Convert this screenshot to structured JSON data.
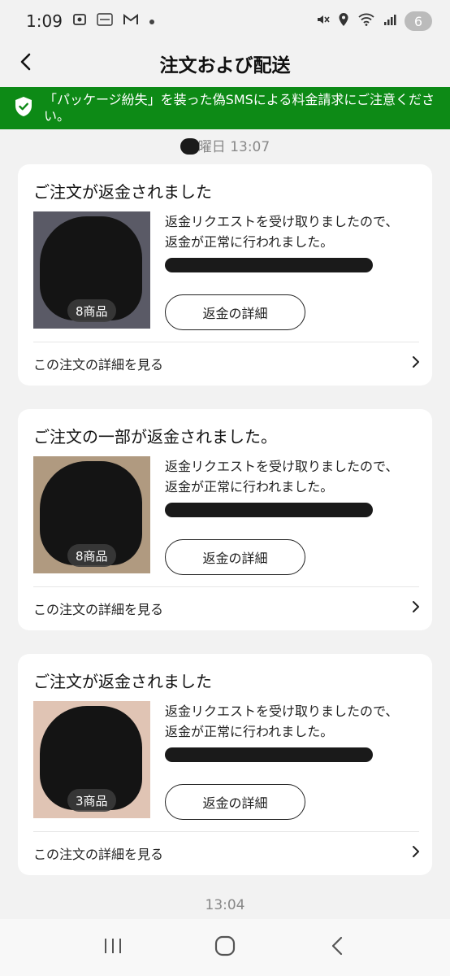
{
  "status_bar": {
    "time": "1:09",
    "icons": [
      "screenshot-icon",
      "temu-icon",
      "gmail-icon",
      "dot-icon"
    ],
    "right_icons": [
      "mute-icon",
      "location-icon",
      "wifi-icon",
      "signal-icon"
    ],
    "notification_count": "6"
  },
  "header": {
    "title": "注文および配送",
    "back_icon": "chevron-left-icon"
  },
  "banner": {
    "text": "「パッケージ紛失」を装った偽SMSによる料金請求にご注意ください。",
    "icon": "shield-check-icon",
    "color": "#0d8a16"
  },
  "date_label": "曜日 13:07",
  "orders": [
    {
      "title": "ご注文が返金されました",
      "message": "返金リクエストを受け取りましたので、返金が正常に行われました。",
      "quantity": "8商品",
      "refund_button": "返金の詳細",
      "detail_link": "この注文の詳細を見る"
    },
    {
      "title": "ご注文の一部が返金されました。",
      "message": "返金リクエストを受け取りましたので、返金が正常に行われました。",
      "quantity": "8商品",
      "refund_button": "返金の詳細",
      "detail_link": "この注文の詳細を見る"
    },
    {
      "title": "ご注文が返金されました",
      "message": "返金リクエストを受け取りましたので、返金が正常に行われました。",
      "quantity": "3商品",
      "refund_button": "返金の詳細",
      "detail_link": "この注文の詳細を見る"
    }
  ],
  "time_label": "13:04",
  "nav": {
    "recents_icon": "recents-icon",
    "home_icon": "home-icon",
    "back_icon": "back-icon"
  }
}
